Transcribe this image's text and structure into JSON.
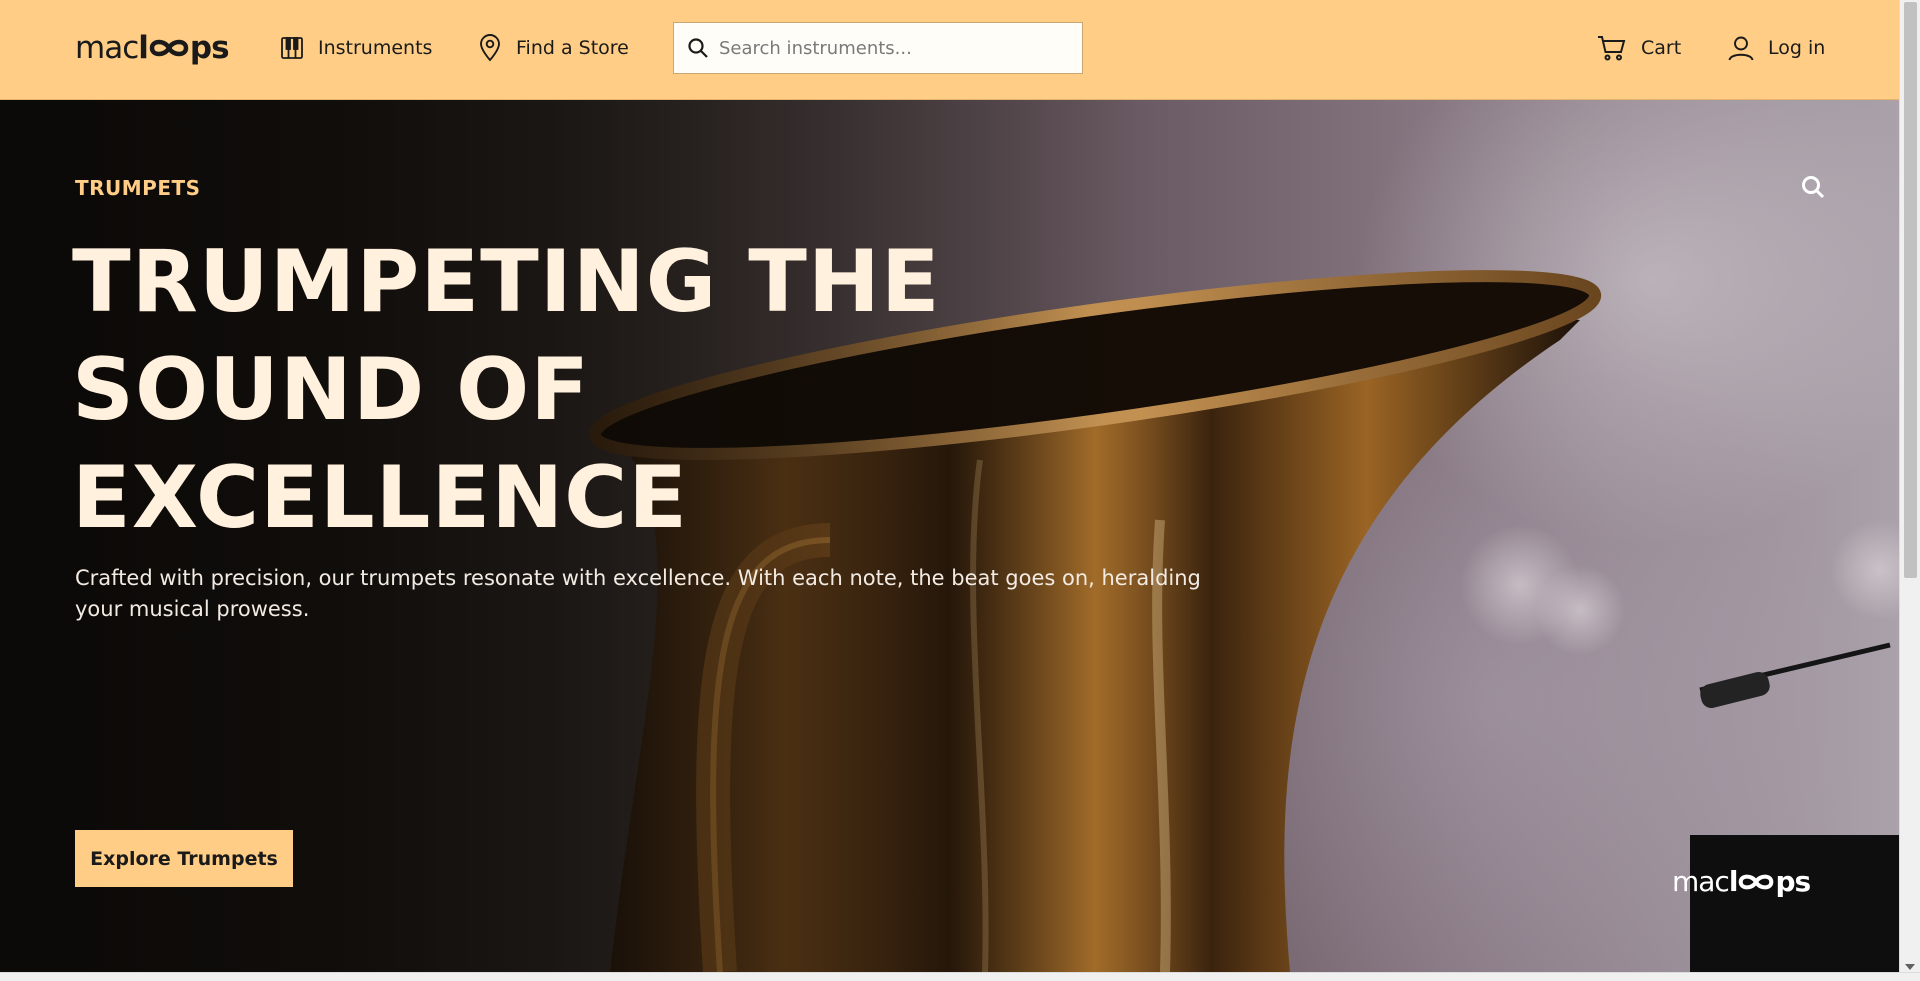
{
  "brand": {
    "logo_prefix": "mac",
    "logo_l": "l",
    "logo_suffix": "ps",
    "logo_icon": "double-o-loop-icon"
  },
  "header": {
    "nav": [
      {
        "label": "Instruments",
        "icon": "piano-keys-icon"
      },
      {
        "label": "Find a Store",
        "icon": "map-pin-icon"
      }
    ],
    "search": {
      "placeholder": "Search instruments...",
      "value": "",
      "icon": "search-icon"
    },
    "cart": {
      "label": "Cart",
      "icon": "shopping-cart-icon"
    },
    "login": {
      "label": "Log in",
      "icon": "user-icon"
    }
  },
  "hero": {
    "eyebrow": "TRUMPETS",
    "title_lines": [
      "TRUMPETING THE",
      "SOUND OF",
      "EXCELLENCE"
    ],
    "description": "Crafted with precision, our trumpets resonate with excellence. With each note, the beat goes on, heralding your musical prowess.",
    "cta_label": "Explore Trumpets",
    "overlay_search_icon": "search-icon",
    "image_subject": "brass-instrument-photo"
  },
  "colors": {
    "accent": "#ffcd85",
    "title_text": "#fff1de",
    "dark_text": "#1a1a1a"
  }
}
